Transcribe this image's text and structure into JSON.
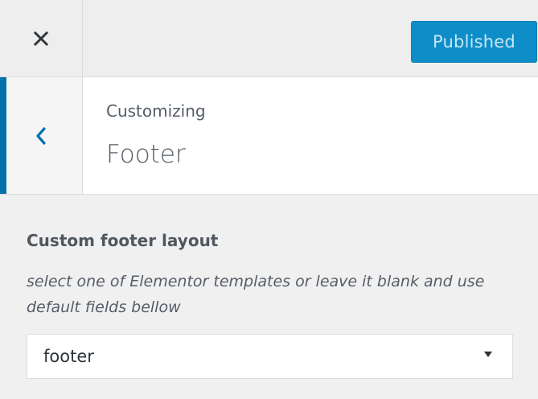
{
  "header": {
    "close_icon": "close-icon",
    "publish_label": "Published"
  },
  "section": {
    "back_icon": "chevron-left-icon",
    "subtitle": "Customizing",
    "title": "Footer"
  },
  "control": {
    "label": "Custom footer layout",
    "description": "select one of Elementor templates or leave it blank and use default fields bellow",
    "select": {
      "selected_value": "footer",
      "caret_icon": "caret-down-icon"
    }
  },
  "colors": {
    "accent": "#0073aa",
    "publish_button": "#0e8ec8",
    "background": "#f0f0f1"
  }
}
